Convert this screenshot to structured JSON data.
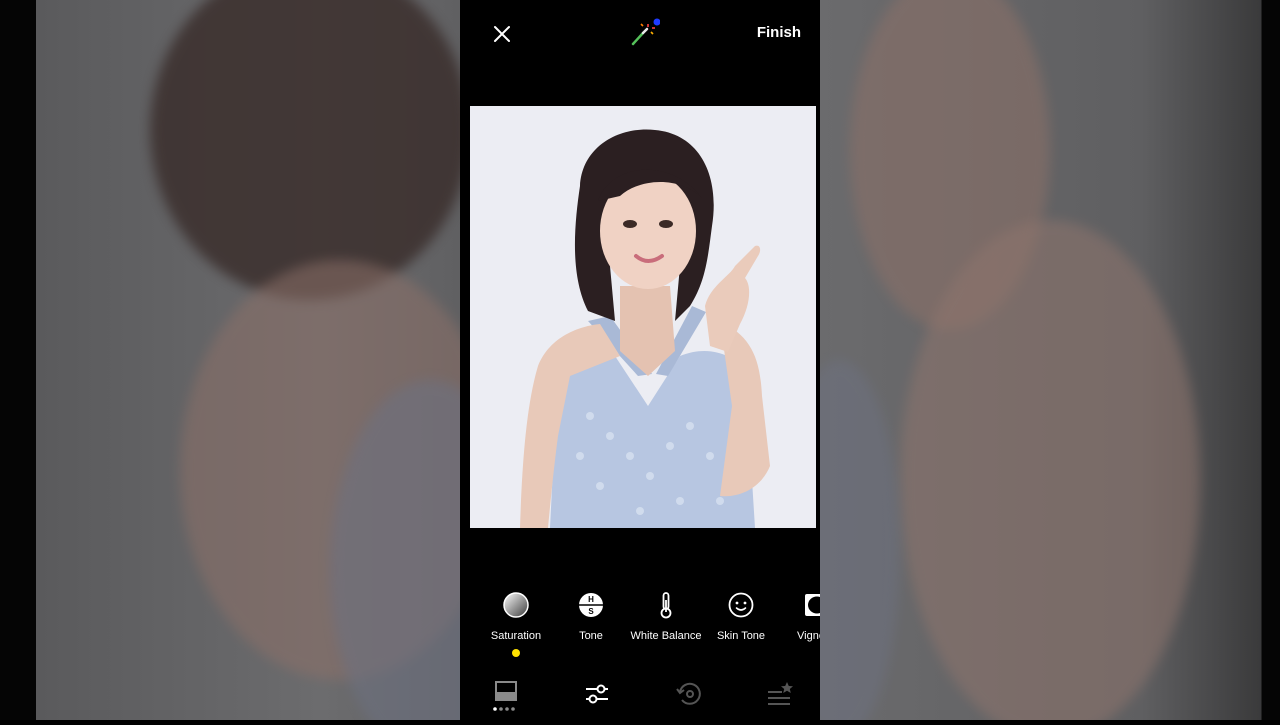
{
  "topbar": {
    "close_icon": "close-icon",
    "magic_icon": "magic-wand-icon",
    "finish_label": "Finish"
  },
  "photo": {
    "description_icon": "portrait-photo"
  },
  "tools": {
    "items": [
      {
        "label": "Saturation",
        "icon": "saturation-icon",
        "active": true
      },
      {
        "label": "Tone",
        "icon": "hs-tone-icon",
        "active": false
      },
      {
        "label": "White Balance",
        "icon": "thermometer-icon",
        "active": false
      },
      {
        "label": "Skin Tone",
        "icon": "smiley-face-icon",
        "active": false
      },
      {
        "label": "Vigne",
        "icon": "vignette-icon",
        "active": false
      }
    ],
    "active_indicator_color": "#ffe200"
  },
  "bottom_nav": {
    "items": [
      {
        "icon": "presets-icon",
        "active": false
      },
      {
        "icon": "adjust-sliders-icon",
        "active": true
      },
      {
        "icon": "history-icon",
        "active": false
      },
      {
        "icon": "favorites-list-icon",
        "active": false
      }
    ]
  }
}
